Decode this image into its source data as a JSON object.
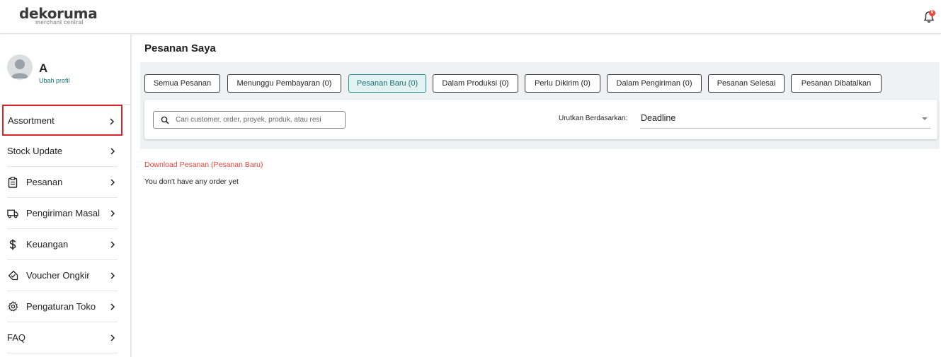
{
  "header": {
    "logo_main": "dekoruma",
    "logo_sub": "merchant central",
    "notification_count": "9"
  },
  "profile": {
    "name": "A",
    "edit_label": "Ubah profil"
  },
  "sidebar": {
    "items": [
      {
        "label": "Assortment",
        "icon": ""
      },
      {
        "label": "Stock Update",
        "icon": ""
      },
      {
        "label": "Pesanan",
        "icon": "clipboard-icon"
      },
      {
        "label": "Pengiriman Masal",
        "icon": "truck-icon"
      },
      {
        "label": "Keuangan",
        "icon": "dollar-icon"
      },
      {
        "label": "Voucher Ongkir",
        "icon": "voucher-tag-icon"
      },
      {
        "label": "Pengaturan Toko",
        "icon": "gear-icon"
      },
      {
        "label": "FAQ",
        "icon": ""
      }
    ]
  },
  "main": {
    "title": "Pesanan Saya",
    "tabs": [
      {
        "label": "Semua Pesanan"
      },
      {
        "label": "Menunggu Pembayaran (0)"
      },
      {
        "label": "Pesanan Baru (0)"
      },
      {
        "label": "Dalam Produksi (0)"
      },
      {
        "label": "Perlu Dikirim (0)"
      },
      {
        "label": "Dalam Pengiriman (0)"
      },
      {
        "label": "Pesanan Selesai"
      },
      {
        "label": "Pesanan Dibatalkan"
      }
    ],
    "active_tab": "Pesanan Baru (0)",
    "search": {
      "placeholder": "Cari customer, order, proyek, produk, atau resi",
      "value": ""
    },
    "sort": {
      "label": "Urutkan Berdasarkan:",
      "value": "Deadline"
    },
    "download_link": "Download Pesanan (Pesanan Baru)",
    "empty_message": "You don't have any order yet"
  },
  "colors": {
    "accent_teal": "#1f8f92",
    "link_red": "#e9473f",
    "highlight_red": "#d6262c"
  }
}
